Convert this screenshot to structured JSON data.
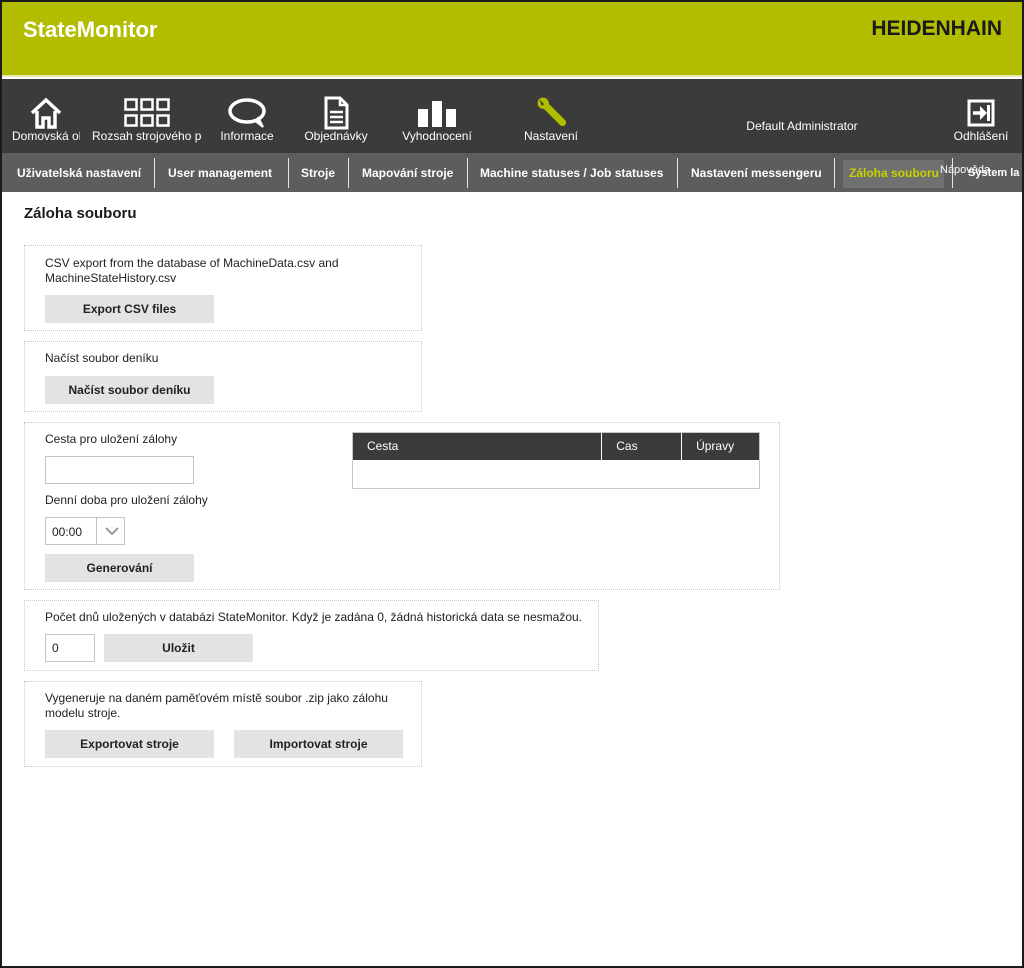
{
  "header": {
    "app_title": "StateMonitor",
    "brand": "HEIDENHAIN",
    "accent_color": "#b3bd00"
  },
  "nav": {
    "items": [
      {
        "label": "Domovská obrazovka",
        "icon": "home-icon"
      },
      {
        "label": "Rozsah strojového parku",
        "icon": "grid-icon"
      },
      {
        "label": "Informace",
        "icon": "speech-bubble-icon"
      },
      {
        "label": "Objednávky",
        "icon": "document-icon"
      },
      {
        "label": "Vyhodnocení",
        "icon": "bar-chart-icon"
      },
      {
        "label": "Nastavení",
        "icon": "wrench-icon"
      }
    ],
    "user": "Default Administrator",
    "logout": {
      "label": "Odhlášení",
      "icon": "logout-icon"
    }
  },
  "subnav": {
    "tabs": [
      "Uživatelská nastavení",
      "User management",
      "Stroje",
      "Mapování stroje",
      "Machine statuses / Job statuses",
      "Nastavení messengeru",
      "Záloha souboru"
    ],
    "overlap_1": "Nápověda",
    "overlap_2": "System la"
  },
  "page": {
    "title": "Záloha souboru",
    "csv_panel": {
      "text_line1": "CSV export from the database of MachineData.csv and",
      "text_line2": "MachineStateHistory.csv",
      "button": "Export CSV files"
    },
    "log_panel": {
      "text": "Načíst soubor deníku",
      "button": "Načíst soubor deníku"
    },
    "backup_panel": {
      "path_label": "Cesta pro uložení zálohy",
      "path_value": "",
      "time_label": "Denní doba pro uložení zálohy",
      "time_value": "00:00",
      "button": "Generování",
      "table_headers": [
        "Cesta",
        "Cas",
        "Úpravy"
      ]
    },
    "retention_panel": {
      "text": "Počet dnů uložených v databázi StateMonitor. Když je zadána 0, žádná historická data se nesmažou.",
      "value": "0",
      "button": "Uložit"
    },
    "machines_panel": {
      "text_line1": "Vygeneruje na daném paměťovém místě soubor .zip jako zálohu",
      "text_line2": "modelu stroje.",
      "export_button": "Exportovat stroje",
      "import_button": "Importovat stroje"
    }
  }
}
